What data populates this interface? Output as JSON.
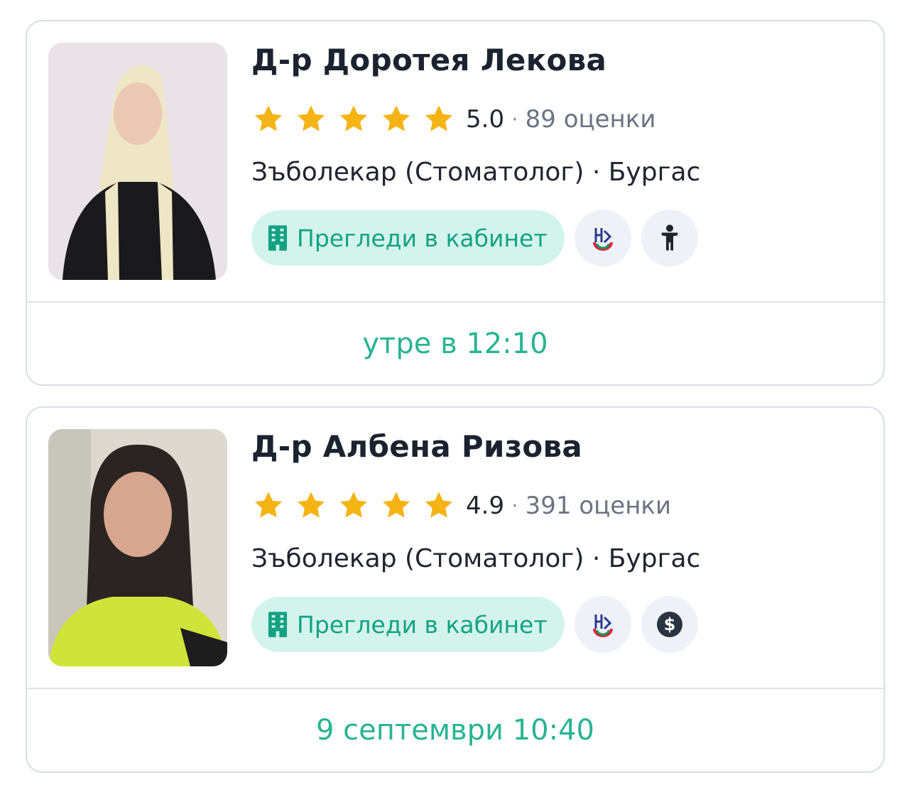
{
  "colors": {
    "accent": "#28b493",
    "pill_background": "#d3f4ec",
    "star": "#f5b414",
    "border": "#d9dee6"
  },
  "doctors": [
    {
      "name": "Д-р Доротея Лекова",
      "rating": "5.0",
      "separator": "·",
      "reviews": "89 оценки",
      "specialty": "Зъболекар (Стоматолог) · Бургас",
      "visit_tag": "Прегледи в кабинет",
      "badges": [
        "nzok-logo-icon",
        "child-icon"
      ],
      "next_slot": "утре в 12:10"
    },
    {
      "name": "Д-р Албена Ризова",
      "rating": "4.9",
      "separator": "·",
      "reviews": "391 оценки",
      "specialty": "Зъболекар (Стоматолог) · Бургас",
      "visit_tag": "Прегледи в кабинет",
      "badges": [
        "nzok-logo-icon",
        "dollar-icon"
      ],
      "next_slot": "9 септември 10:40"
    }
  ]
}
